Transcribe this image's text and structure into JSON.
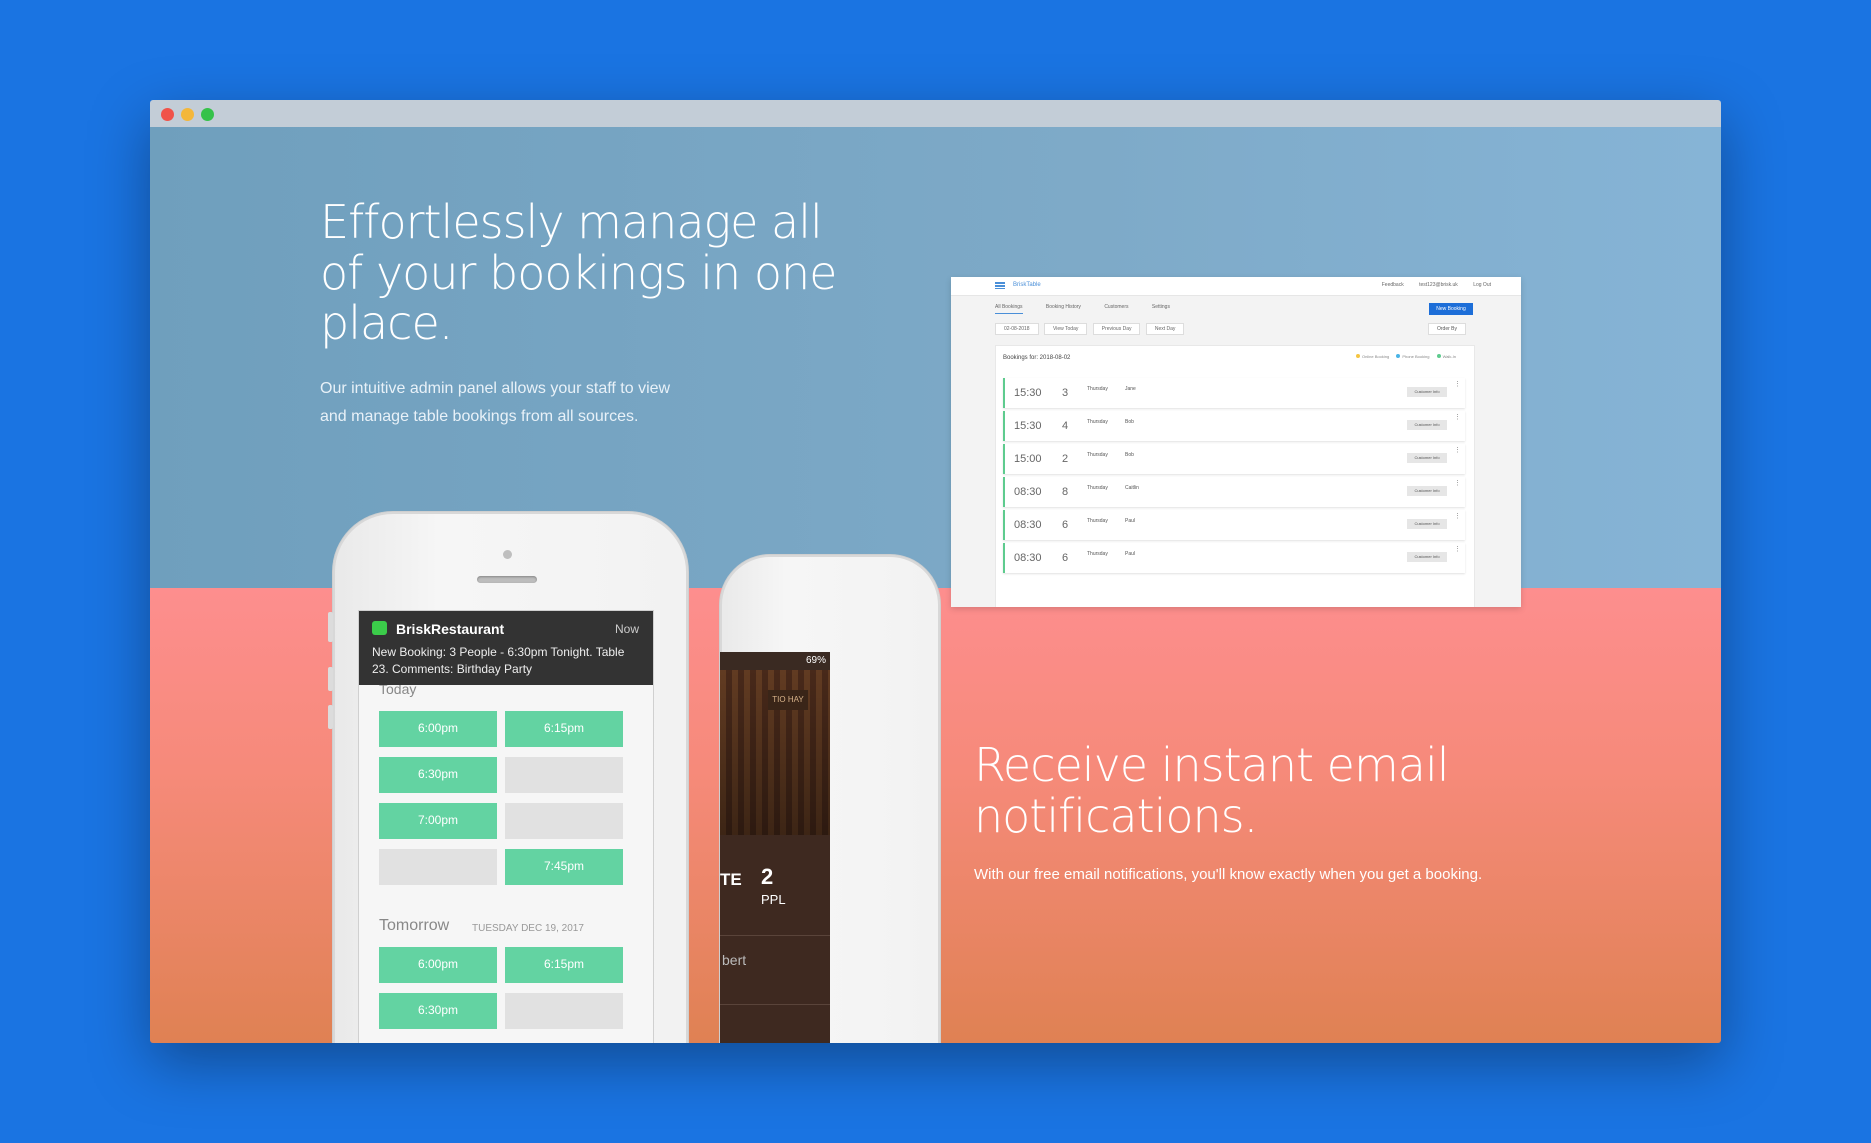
{
  "hero": {
    "title": "Effortlessly manage all of your bookings in one place.",
    "subtitle": "Our intuitive admin panel allows your staff to view and manage table bookings from all sources."
  },
  "email_section": {
    "title": "Receive instant email notifications.",
    "subtitle": "With our free email notifications, you'll know exactly when you get a booking."
  },
  "admin": {
    "brand": "BriskTable",
    "top_links": [
      "Feedback",
      "test123@brisk.uk",
      "Log Out"
    ],
    "tabs": [
      "All Bookings",
      "Booking History",
      "Customers",
      "Settings"
    ],
    "new_booking": "New Booking",
    "toolbar": [
      "02-08-2018",
      "View Today",
      "Previous Day",
      "Next Day"
    ],
    "order_by": "Order By",
    "panel_title": "Bookings for: 2018-08-02",
    "legend": [
      "Online Booking",
      "Phone Booking",
      "Walk-In"
    ],
    "legend_colors": [
      "#f5c542",
      "#4ab4e6",
      "#5ecb8e"
    ],
    "customer_info_label": "Customer Info",
    "rows": [
      {
        "time": "15:30",
        "people": "3",
        "day": "Thursday",
        "name": "Jane"
      },
      {
        "time": "15:30",
        "people": "4",
        "day": "Thursday",
        "name": "Bob"
      },
      {
        "time": "15:00",
        "people": "2",
        "day": "Thursday",
        "name": "Bob"
      },
      {
        "time": "08:30",
        "people": "8",
        "day": "Thursday",
        "name": "Caitlin"
      },
      {
        "time": "08:30",
        "people": "6",
        "day": "Thursday",
        "name": "Paul"
      },
      {
        "time": "08:30",
        "people": "6",
        "day": "Thursday",
        "name": "Paul"
      }
    ]
  },
  "phone": {
    "notification": {
      "app": "BriskRestaurant",
      "when": "Now",
      "message": "New Booking: 3 People - 6:30pm Tonight. Table 23. Comments: Birthday Party"
    },
    "today_label": "Today",
    "today_slots": [
      "6:00pm",
      "6:15pm",
      "6:30pm",
      "",
      "7:00pm",
      "",
      "",
      "7:45pm"
    ],
    "tomorrow_label": "Tomorrow",
    "tomorrow_date": "TUESDAY DEC 19, 2017",
    "tomorrow_slots": [
      "6:00pm",
      "6:15pm",
      "6:30pm",
      ""
    ]
  },
  "phone2": {
    "status": "69%",
    "sign": "TIO HAY",
    "te": "TE",
    "count": "2",
    "ppl": "PPL",
    "name_fragment": "bert"
  },
  "colors": {
    "background": "#1a74e2",
    "top_section": "#7eaac8",
    "bottom_section": "#f68a7a",
    "slot_available": "#63d3a2",
    "admin_accent": "#1d6ed8"
  }
}
